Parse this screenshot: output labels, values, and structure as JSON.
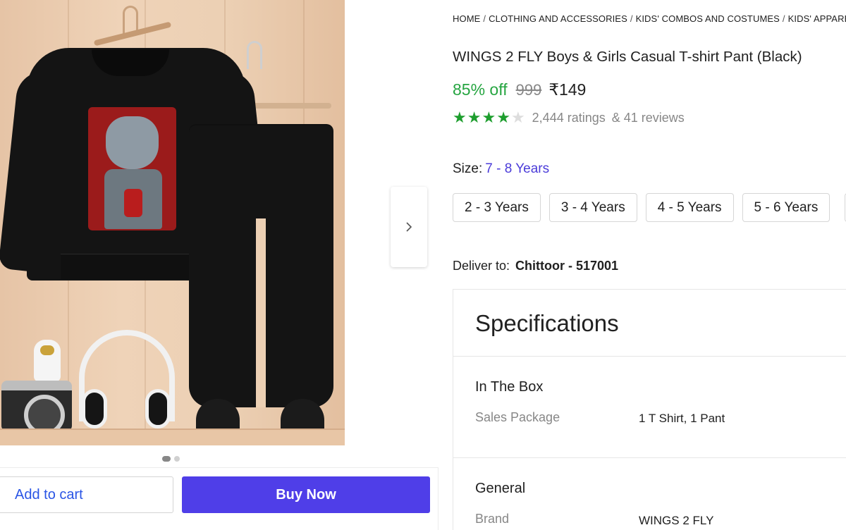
{
  "breadcrumb": {
    "items": [
      "HOME",
      "CLOTHING AND ACCESSORIES",
      "KIDS' COMBOS AND COSTUMES",
      "KIDS' APPAREL"
    ],
    "separator": "/"
  },
  "product": {
    "title": "WINGS 2 FLY Boys & Girls Casual T-shirt Pant  (Black)",
    "discount": "85% off",
    "mrp": "999",
    "price": "₹149",
    "rating_stars": 4,
    "rating_count": "2,444 ratings",
    "review_count": "& 41 reviews"
  },
  "gallery": {
    "image_alt": "product-photo",
    "slide_count": 2,
    "active_slide": 1,
    "next_icon": "chevron-right-icon"
  },
  "size": {
    "label": "Size:",
    "selected": "7 - 8 Years",
    "options": [
      "2 - 3 Years",
      "3 - 4 Years",
      "4 - 5 Years",
      "5 - 6 Years"
    ]
  },
  "delivery": {
    "label": "Deliver to:",
    "location": "Chittoor - 517001"
  },
  "actions": {
    "add_to_cart": "Add to cart",
    "buy_now": "Buy Now"
  },
  "specifications": {
    "title": "Specifications",
    "groups": [
      {
        "title": "In The Box",
        "rows": [
          {
            "key": "Sales Package",
            "value": "1 T Shirt, 1 Pant"
          }
        ]
      },
      {
        "title": "General",
        "rows": [
          {
            "key": "Brand",
            "value": "WINGS 2 FLY"
          }
        ]
      }
    ]
  },
  "colors": {
    "discount_green": "#26a541",
    "star_green": "#1e9e2e",
    "buy_button": "#4f3ee8",
    "link_blue": "#2a55e5",
    "size_selected": "#4b3cd9"
  }
}
